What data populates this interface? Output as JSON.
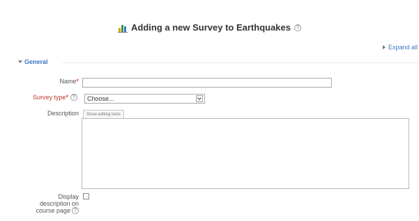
{
  "page": {
    "title": "Adding a new Survey to Earthquakes",
    "title_icon": "survey-chart-icon",
    "help_icon": "help-icon"
  },
  "toolbar": {
    "expand_all_label": "Expand all"
  },
  "section": {
    "legend": "General"
  },
  "form": {
    "name": {
      "label": "Name",
      "required_mark": "*",
      "value": ""
    },
    "survey_type": {
      "label": "Survey type",
      "required_mark": "*",
      "selected": "Choose..."
    },
    "description": {
      "label": "Description",
      "editor_toggle": "Show editing tools",
      "value": ""
    },
    "display_description": {
      "label_line1": "Display",
      "label_line2": "description on",
      "label_line3": "course page",
      "checked": false
    }
  },
  "colors": {
    "link": "#3a77c5",
    "required": "#cc0000",
    "text": "#333333"
  }
}
